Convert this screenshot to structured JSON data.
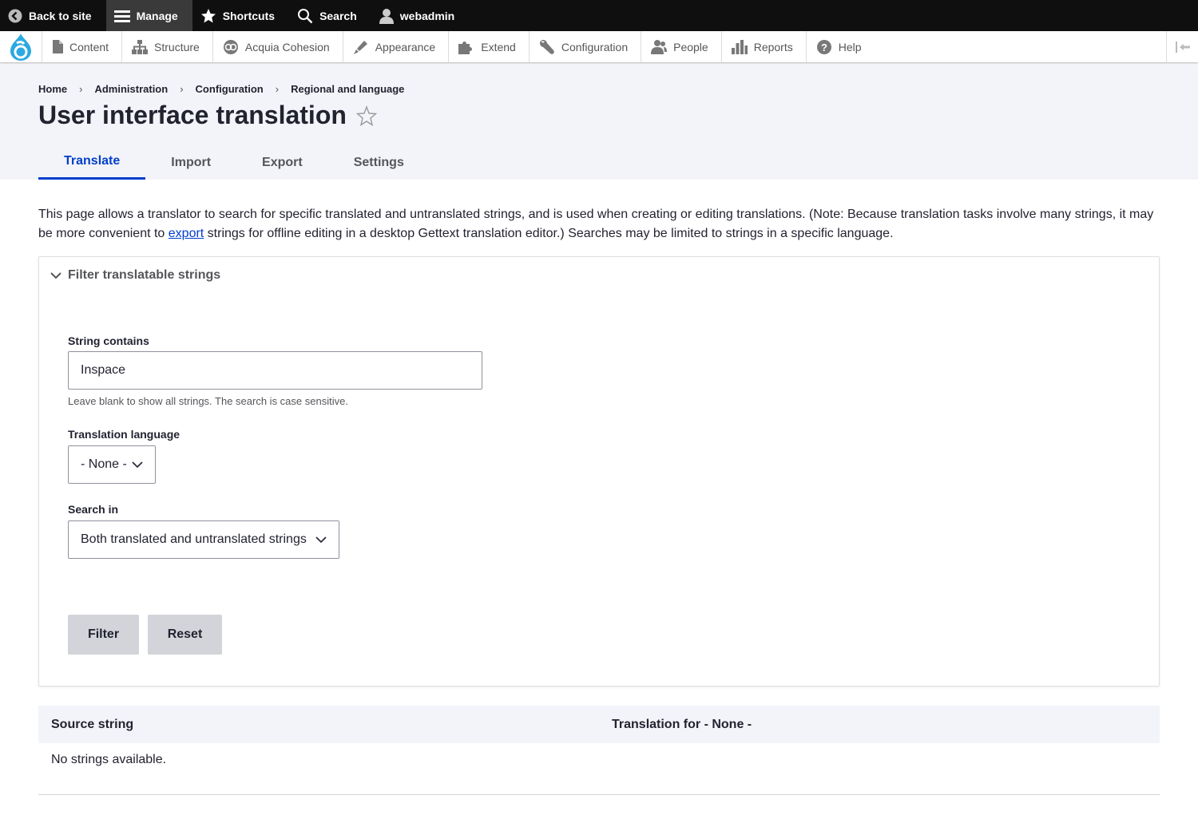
{
  "toolbar": {
    "back_to_site": "Back to site",
    "manage": "Manage",
    "shortcuts": "Shortcuts",
    "search": "Search",
    "user": "webadmin"
  },
  "tray": {
    "items": [
      {
        "label": "Content",
        "icon": "file-icon"
      },
      {
        "label": "Structure",
        "icon": "sitemap-icon"
      },
      {
        "label": "Acquia Cohesion",
        "icon": "cohesion-icon"
      },
      {
        "label": "Appearance",
        "icon": "paintbrush-icon"
      },
      {
        "label": "Extend",
        "icon": "puzzle-icon"
      },
      {
        "label": "Configuration",
        "icon": "wrench-icon"
      },
      {
        "label": "People",
        "icon": "people-icon"
      },
      {
        "label": "Reports",
        "icon": "bar-chart-icon"
      },
      {
        "label": "Help",
        "icon": "help-icon"
      }
    ]
  },
  "breadcrumb": [
    "Home",
    "Administration",
    "Configuration",
    "Regional and language"
  ],
  "page_title": "User interface translation",
  "tabs": [
    "Translate",
    "Import",
    "Export",
    "Settings"
  ],
  "description": {
    "before_link": "This page allows a translator to search for specific translated and untranslated strings, and is used when creating or editing translations. (Note: Because translation tasks involve many strings, it may be more convenient to ",
    "link": "export",
    "after_link": " strings for offline editing in a desktop Gettext translation editor.) Searches may be limited to strings in a specific language."
  },
  "filter": {
    "summary": "Filter translatable strings",
    "string_label": "String contains",
    "string_value": "Inspace",
    "string_help": "Leave blank to show all strings. The search is case sensitive.",
    "language_label": "Translation language",
    "language_value": "- None -",
    "search_in_label": "Search in",
    "search_in_value": "Both translated and untranslated strings",
    "filter_button": "Filter",
    "reset_button": "Reset"
  },
  "table": {
    "col_source": "Source string",
    "col_translation": "Translation for - None -",
    "empty": "No strings available."
  },
  "colors": {
    "accent": "#003ecc",
    "header_bg": "#f3f4f9",
    "drupal_blue": "#2ba9e0"
  }
}
